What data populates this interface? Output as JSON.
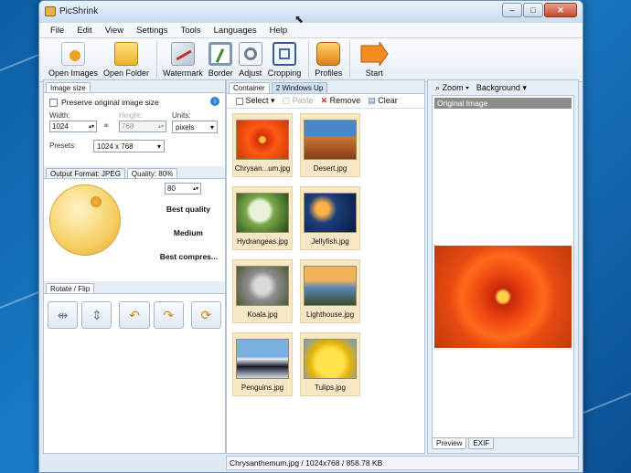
{
  "window": {
    "title": "PicShrink"
  },
  "menu": [
    "File",
    "Edit",
    "View",
    "Settings",
    "Tools",
    "Languages",
    "Help"
  ],
  "toolbar": [
    {
      "label": "Open Images",
      "icon": "open-images-icon"
    },
    {
      "label": "Open Folder",
      "icon": "open-folder-icon"
    },
    {
      "label": "Watermark",
      "icon": "watermark-icon"
    },
    {
      "label": "Border",
      "icon": "border-icon"
    },
    {
      "label": "Adjust",
      "icon": "adjust-icon"
    },
    {
      "label": "Cropping",
      "icon": "cropping-icon"
    },
    {
      "label": "Profiles",
      "icon": "profiles-icon"
    },
    {
      "label": "Start",
      "icon": "start-arrow-icon"
    }
  ],
  "image_size": {
    "tab": "Image size",
    "preserve_label": "Preserve original image size",
    "width_label": "Width:",
    "width_value": "1024",
    "height_label": "Height:",
    "height_value": "768",
    "units_label": "Units:",
    "units_value": "pixels",
    "presets_label": "Presets:",
    "presets_value": "1024 x 768"
  },
  "output": {
    "tab_format": "Output Format: JPEG",
    "tab_quality": "Quality: 80%",
    "quality_value": "80",
    "best_quality": "Best quality",
    "medium": "Medium",
    "best_compression": "Best compres..."
  },
  "rotate": {
    "tab": "Rotate / Flip"
  },
  "container": {
    "tab_container": "Container",
    "tab_windows": "2 Windows Up",
    "select_label": "Select",
    "paste_label": "Paste",
    "remove_label": "Remove",
    "clear_label": "Clear",
    "thumbnails": [
      {
        "name": "Chrysan...um.jpg"
      },
      {
        "name": "Desert.jpg"
      },
      {
        "name": "Hydrangeas.jpg"
      },
      {
        "name": "Jellyfish.jpg"
      },
      {
        "name": "Koala.jpg"
      },
      {
        "name": "Lighthouse.jpg"
      },
      {
        "name": "Penguins.jpg"
      },
      {
        "name": "Tulips.jpg"
      }
    ]
  },
  "preview": {
    "zoom_label": "Zoom",
    "background_label": "Background",
    "original_label": "Original Image",
    "tab_preview": "Preview",
    "tab_exif": "EXIF"
  },
  "status": "Chrysanthemum.jpg / 1024x768 / 858.78 KB",
  "colors": {
    "accent": "#1f6fc0",
    "thumb_bg": "#f7e7c4"
  }
}
